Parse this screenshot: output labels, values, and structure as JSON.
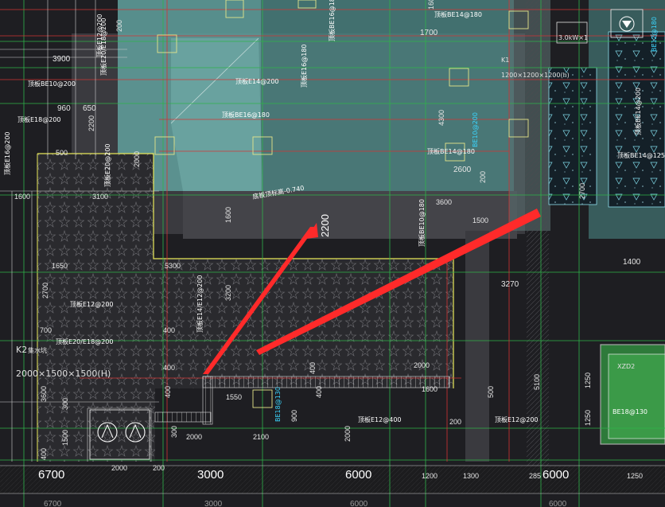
{
  "drawing": {
    "annotation": "2200",
    "axis_spans": [
      "6700",
      "3000",
      "6000",
      "6000"
    ],
    "axis_spans_lower": [
      "6700",
      "3000",
      "6000",
      "6000"
    ],
    "pit_k1": {
      "name": "K1",
      "size": "1200×1200×1200(h)"
    },
    "pit_k2": {
      "name": "K2",
      "desc": "集水坑",
      "size": "2000×1500×1500(H)"
    },
    "pit_xzd2": {
      "name": "XZD2",
      "rebar": "BE18@130"
    },
    "device_label": "3.0kW×1",
    "dimensions": {
      "top_left": [
        "3900",
        "960",
        "650",
        "2200",
        "500",
        "1600",
        "3100",
        "2000",
        "1650",
        "2700",
        "700",
        "400",
        "3600",
        "300",
        "1500",
        "400"
      ],
      "upper_mid": [
        "1700",
        "1600",
        "200",
        "4300",
        "2600",
        "3600",
        "1500",
        "1600",
        "200"
      ],
      "center": [
        "5300",
        "3200",
        "400",
        "400",
        "1550",
        "400",
        "300",
        "2000",
        "2100",
        "900",
        "2000",
        "1600",
        "2000",
        "400",
        "200",
        "500"
      ],
      "right": [
        "1400",
        "3270",
        "5100",
        "2700",
        "1250",
        "1250"
      ],
      "bottom": [
        "2000",
        "200",
        "1200",
        "1300",
        "285",
        "1250"
      ]
    },
    "rebar_labels": [
      "顶板E14@200",
      "顶板BE16@180",
      "顶板BE14@180",
      "顶板BE16@180",
      "顶板E16@180",
      "顶板BE10@200",
      "顶板E18@200",
      "顶板E20/E18@200",
      "顶板E12@200",
      "顶板E20/E18@200",
      "顶板E14/E12@200",
      "顶板E16@200",
      "顶板E12@400",
      "顶板BE14@125",
      "顶板BE14@200",
      "顶板E20@200",
      "顶板BE14@180",
      "顶板E12@200",
      "顶板BE10@180",
      "顶板E12@200"
    ],
    "cyan_labels": [
      "BE10@200",
      "BE18@130",
      "BE12@180"
    ],
    "elevation_note": "底板顶标高-0.740"
  }
}
